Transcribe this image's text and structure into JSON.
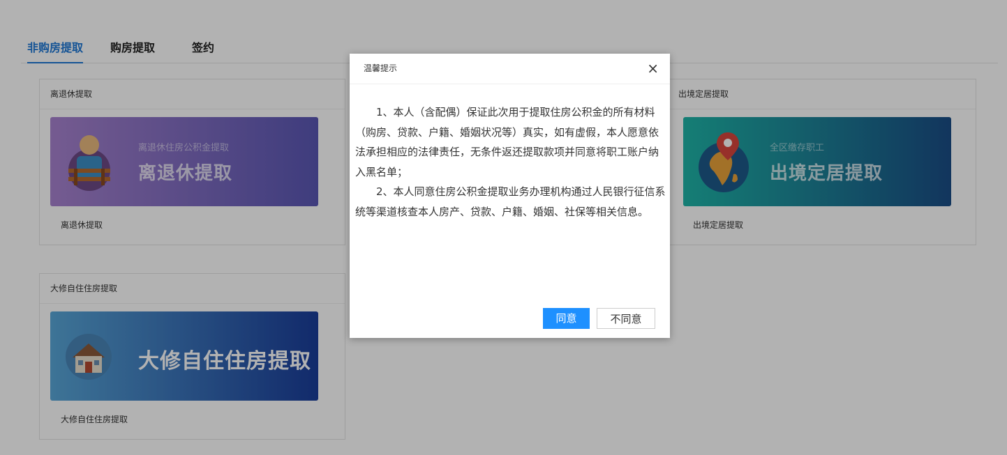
{
  "tabs": [
    "非购房提取",
    "购房提取",
    "签约"
  ],
  "cards": {
    "retire": {
      "header": "离退休提取",
      "subtitle": "离退休住房公积金提取",
      "title": "离退休提取",
      "caption": "离退休提取",
      "gradient": [
        "#a883cf",
        "#5a57b4"
      ]
    },
    "abroad": {
      "header": "出境定居提取",
      "subtitle": "全区缴存职工",
      "title": "出境定居提取",
      "caption": "出境定居提取",
      "gradient": [
        "#1fb5a8",
        "#1a4d86"
      ]
    },
    "repair": {
      "header": "大修自住住房提取",
      "title": "大修自住住房提取",
      "caption": "大修自住住房提取",
      "gradient": [
        "#59a7d8",
        "#1a3d9a"
      ]
    }
  },
  "modal": {
    "title": "温馨提示",
    "close": "×",
    "paragraphs": [
      "1、本人（含配偶）保证此次用于提取住房公积金的所有材料（购房、贷款、户籍、婚姻状况等）真实，如有虚假，本人愿意依法承担相应的法律责任，无条件返还提取款项并同意将职工账户纳入黑名单；",
      "2、本人同意住房公积金提取业务办理机构通过人民银行征信系统等渠道核查本人房产、贷款、户籍、婚姻、社保等相关信息。"
    ],
    "agree": "同意",
    "disagree": "不同意"
  },
  "colors": {
    "accent": "#1e78d6",
    "agree_button": "#1e90ff",
    "overlay": "rgba(0,0,0,0.3)"
  }
}
